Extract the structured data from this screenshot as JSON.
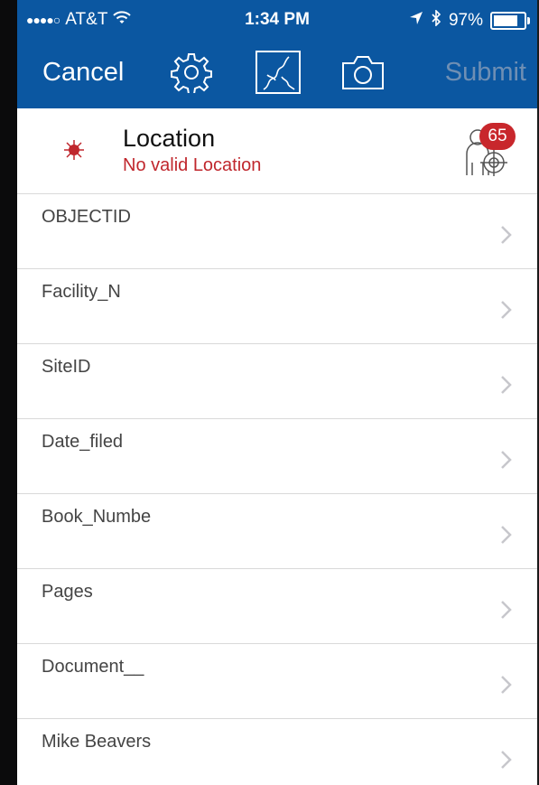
{
  "status_bar": {
    "signal": "●●●●○",
    "carrier": "AT&T",
    "time": "1:34 PM",
    "battery": "97%",
    "battery_level": 0.97
  },
  "toolbar": {
    "cancel_label": "Cancel",
    "submit_label": "Submit",
    "icons": [
      "gear-icon",
      "map-icon",
      "camera-icon"
    ]
  },
  "location": {
    "title": "Location",
    "status": "No valid Location",
    "badge_count": "65",
    "status_color": "#c0272d"
  },
  "fields": [
    {
      "label": "OBJECTID"
    },
    {
      "label": "Facility_N"
    },
    {
      "label": "SiteID"
    },
    {
      "label": "Date_filed"
    },
    {
      "label": "Book_Numbe"
    },
    {
      "label": "Pages"
    },
    {
      "label": "Document__"
    },
    {
      "label": "Mike Beavers"
    }
  ],
  "colors": {
    "header": "#0b57a1",
    "badge": "#c8272c",
    "submit_disabled": "#6f8fb4"
  }
}
